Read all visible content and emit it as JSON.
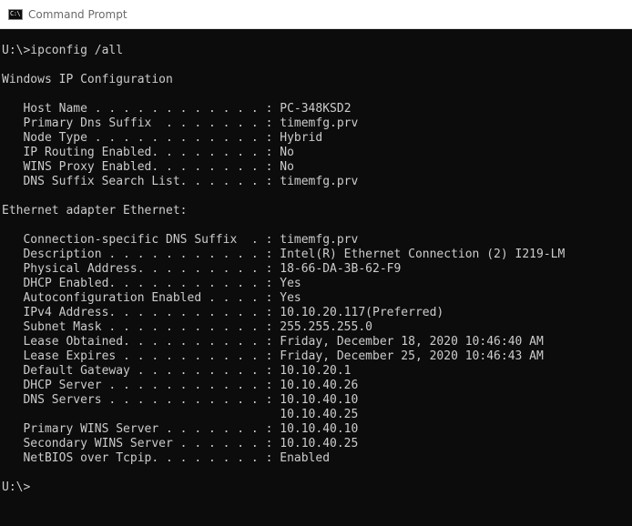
{
  "window": {
    "title": "Command Prompt",
    "icon_text": "C:\\",
    "icon": "cmd-console-icon",
    "colors": {
      "background": "#0c0c0c",
      "text": "#cccccc",
      "highlight": "#f0d000",
      "titlebar": "#ffffff"
    }
  },
  "console": {
    "command_line": "U:\\>ipconfig /all",
    "config_header": "Windows IP Configuration",
    "host_name": {
      "label": "   Host Name . . . . . . . . . . . . : ",
      "value": "PC-348KSD2"
    },
    "primary_dns_suffix": "   Primary Dns Suffix  . . . . . . . : timemfg.prv",
    "node_type": "   Node Type . . . . . . . . . . . . : Hybrid",
    "ip_routing": "   IP Routing Enabled. . . . . . . . : No",
    "wins_proxy": "   WINS Proxy Enabled. . . . . . . . : No",
    "dns_suffix_search": "   DNS Suffix Search List. . . . . . : timemfg.prv",
    "adapter_header": "Ethernet adapter Ethernet:",
    "conn_dns_suffix": "   Connection-specific DNS Suffix  . : timemfg.prv",
    "description": "   Description . . . . . . . . . . . : Intel(R) Ethernet Connection (2) I219-LM",
    "physical_address": "   Physical Address. . . . . . . . . : 18-66-DA-3B-62-F9",
    "dhcp_enabled": "   DHCP Enabled. . . . . . . . . . . : Yes",
    "autoconfig": "   Autoconfiguration Enabled . . . . : Yes",
    "ipv4": {
      "label": "   IPv4 Address. . . . . . . . . . . : ",
      "value": "10.10.20.117(Preferred)"
    },
    "subnet_mask": "   Subnet Mask . . . . . . . . . . . : 255.255.255.0",
    "lease_obtained": "   Lease Obtained. . . . . . . . . . : Friday, December 18, 2020 10:46:40 AM",
    "lease_expires": "   Lease Expires . . . . . . . . . . : Friday, December 25, 2020 10:46:43 AM",
    "default_gateway": "   Default Gateway . . . . . . . . . : 10.10.20.1",
    "dhcp_server": "   DHCP Server . . . . . . . . . . . : 10.10.40.26",
    "dns_servers": "   DNS Servers . . . . . . . . . . . : 10.10.40.10",
    "dns_servers_2": "                                       10.10.40.25",
    "primary_wins": "   Primary WINS Server . . . . . . . : 10.10.40.10",
    "secondary_wins": "   Secondary WINS Server . . . . . . : 10.10.40.25",
    "netbios": "   NetBIOS over Tcpip. . . . . . . . : Enabled",
    "prompt": "U:\\>"
  }
}
